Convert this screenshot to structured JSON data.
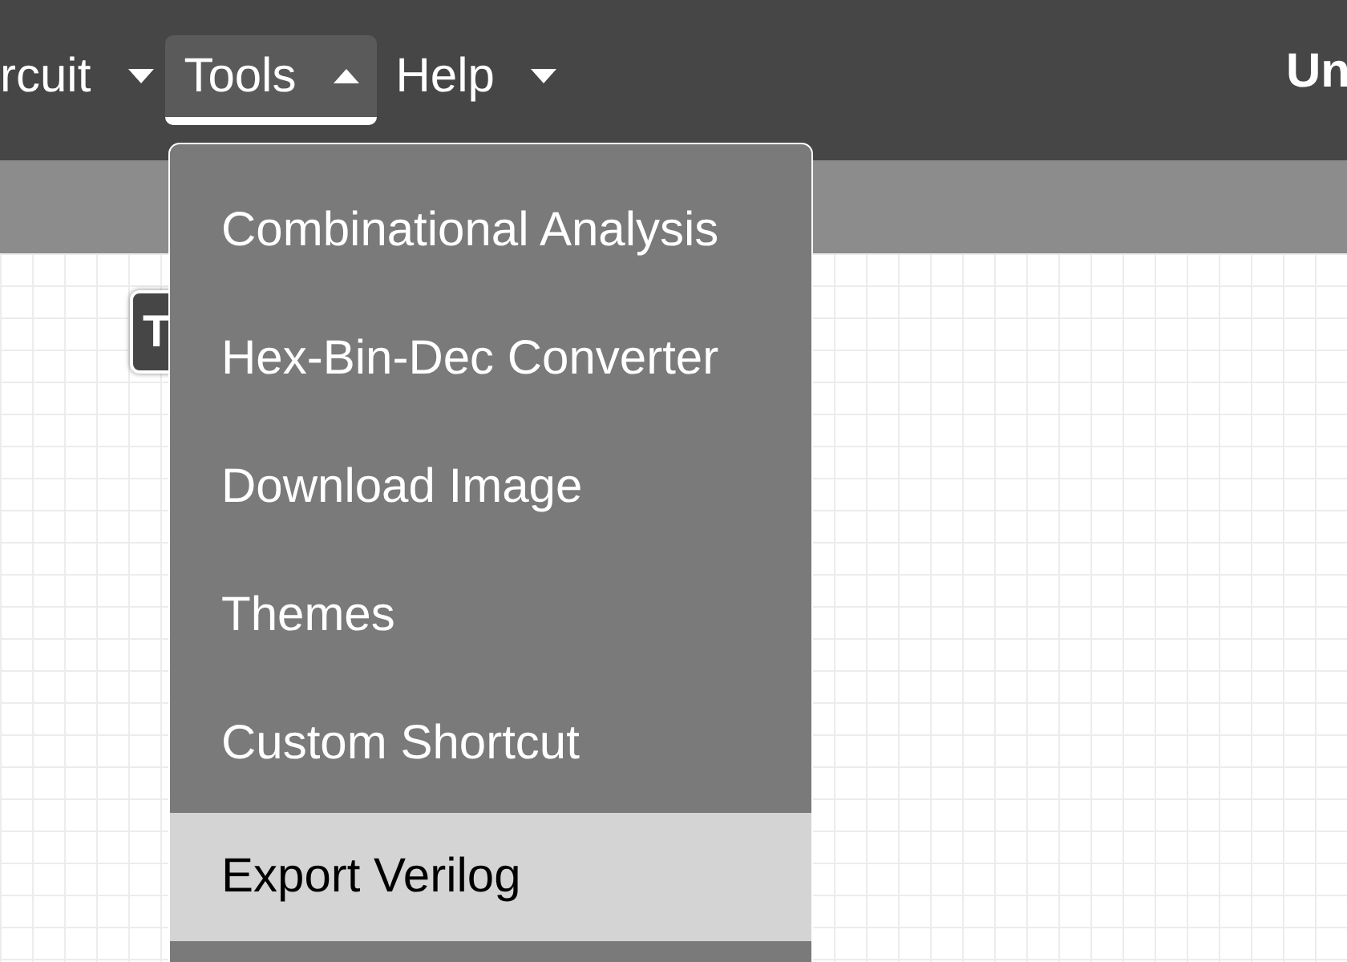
{
  "menubar": {
    "items": [
      {
        "label": "rcuit",
        "expanded": false
      },
      {
        "label": "Tools",
        "expanded": true
      },
      {
        "label": "Help",
        "expanded": false
      }
    ],
    "title": "Un"
  },
  "canvas": {
    "tag": "T"
  },
  "dropdown": {
    "items": [
      {
        "label": "Combinational Analysis",
        "selected": false
      },
      {
        "label": "Hex-Bin-Dec Converter",
        "selected": false
      },
      {
        "label": "Download Image",
        "selected": false
      },
      {
        "label": "Themes",
        "selected": false
      },
      {
        "label": "Custom Shortcut",
        "selected": false
      },
      {
        "label": "Export Verilog",
        "selected": true
      }
    ]
  }
}
